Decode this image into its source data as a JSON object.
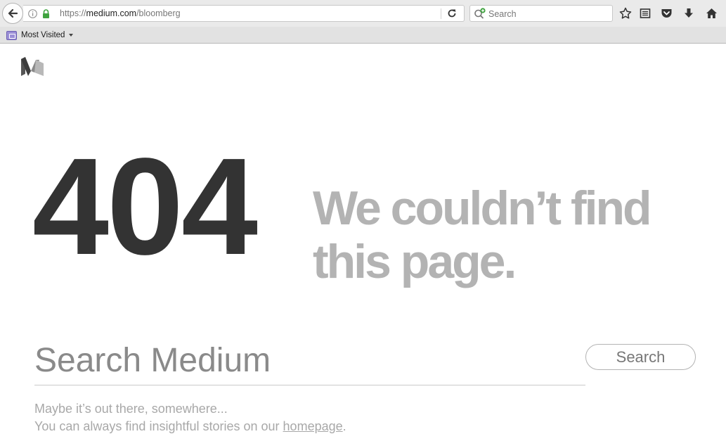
{
  "browser": {
    "url_prefix": "https://",
    "url_host": "medium.com",
    "url_path": "/bloomberg",
    "search_placeholder": "Search",
    "bookmarks_label": "Most Visited"
  },
  "page": {
    "error_code": "404",
    "headline": "We couldn’t find this page.",
    "search_placeholder": "Search Medium",
    "search_button": "Search",
    "message_line1": "Maybe it’s out there, somewhere...",
    "message_line2_prefix": "You can always find insightful stories on our ",
    "homepage_link": "homepage",
    "message_line2_suffix": "."
  },
  "colors": {
    "error_code": "#333333",
    "headline": "#b3b3b3",
    "muted_text": "#a8a8a8"
  },
  "icons": [
    "back-arrow-icon",
    "info-icon",
    "lock-icon",
    "reload-icon",
    "search-icon",
    "star-icon",
    "reading-list-icon",
    "pocket-icon",
    "download-icon",
    "home-icon",
    "bookmark-folder-icon",
    "medium-logo"
  ]
}
